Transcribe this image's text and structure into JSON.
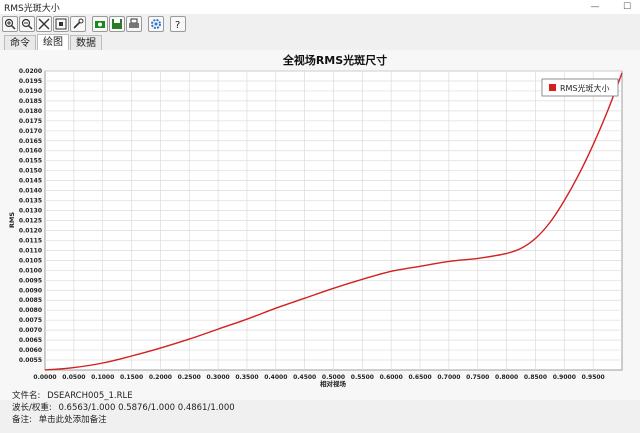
{
  "window": {
    "title": "RMS光斑大小",
    "minimize": "—",
    "maximize": "☐"
  },
  "toolbar": {
    "buttons": [
      {
        "name": "zoom-in-icon"
      },
      {
        "name": "zoom-out-icon"
      },
      {
        "name": "tools-icon"
      },
      {
        "name": "fit-icon"
      },
      {
        "name": "wrench-icon"
      },
      {
        "name": "camera-icon"
      },
      {
        "name": "save-icon"
      },
      {
        "name": "print-icon"
      },
      {
        "name": "settings-icon"
      },
      {
        "name": "help-icon"
      }
    ]
  },
  "tabs": [
    {
      "label": "命令",
      "active": false
    },
    {
      "label": "绘图",
      "active": true
    },
    {
      "label": "数据",
      "active": false
    }
  ],
  "chart_data": {
    "type": "line",
    "title": "全视场RMS光斑尺寸",
    "xlabel": "相对视场",
    "ylabel": "RMS",
    "xlim": [
      0,
      1
    ],
    "ylim": [
      0.005,
      0.02
    ],
    "grid": true,
    "legend_placement": "top-right",
    "x_ticks": [
      "0.0000",
      "0.0500",
      "0.1000",
      "0.1500",
      "0.2000",
      "0.2500",
      "0.3000",
      "0.3500",
      "0.4000",
      "0.4500",
      "0.5000",
      "0.5500",
      "0.6000",
      "0.6500",
      "0.7000",
      "0.7500",
      "0.8000",
      "0.8500",
      "0.9000",
      "0.9500"
    ],
    "y_ticks": [
      "0.0055",
      "0.0060",
      "0.0065",
      "0.0070",
      "0.0075",
      "0.0080",
      "0.0085",
      "0.0090",
      "0.0095",
      "0.0100",
      "0.0105",
      "0.0110",
      "0.0115",
      "0.0120",
      "0.0125",
      "0.0130",
      "0.0135",
      "0.0140",
      "0.0145",
      "0.0150",
      "0.0155",
      "0.0160",
      "0.0165",
      "0.0170",
      "0.0175",
      "0.0180",
      "0.0185",
      "0.0190",
      "0.0195",
      "0.0200"
    ],
    "series": [
      {
        "name": "RMS光斑大小",
        "color": "#d32020",
        "x": [
          0.0,
          0.05,
          0.1,
          0.15,
          0.2,
          0.25,
          0.3,
          0.35,
          0.4,
          0.45,
          0.5,
          0.55,
          0.6,
          0.65,
          0.7,
          0.75,
          0.8,
          0.825,
          0.85,
          0.875,
          0.9,
          0.925,
          0.95,
          0.975,
          1.0
        ],
        "y": [
          0.005,
          0.00512,
          0.00535,
          0.0057,
          0.0061,
          0.00655,
          0.00705,
          0.00755,
          0.0081,
          0.0086,
          0.0091,
          0.00955,
          0.00995,
          0.0102,
          0.01045,
          0.0106,
          0.01085,
          0.0111,
          0.0116,
          0.0124,
          0.0135,
          0.0148,
          0.0163,
          0.018,
          0.0199
        ]
      }
    ]
  },
  "footer": {
    "file_label": "文件名:",
    "file_value": "DSEARCH005_1.RLE",
    "wave_label": "波长/权重:",
    "wave_value": "0.6563/1.000  0.5876/1.000  0.4861/1.000",
    "note_label": "备注:",
    "note_value": "单击此处添加备注"
  }
}
